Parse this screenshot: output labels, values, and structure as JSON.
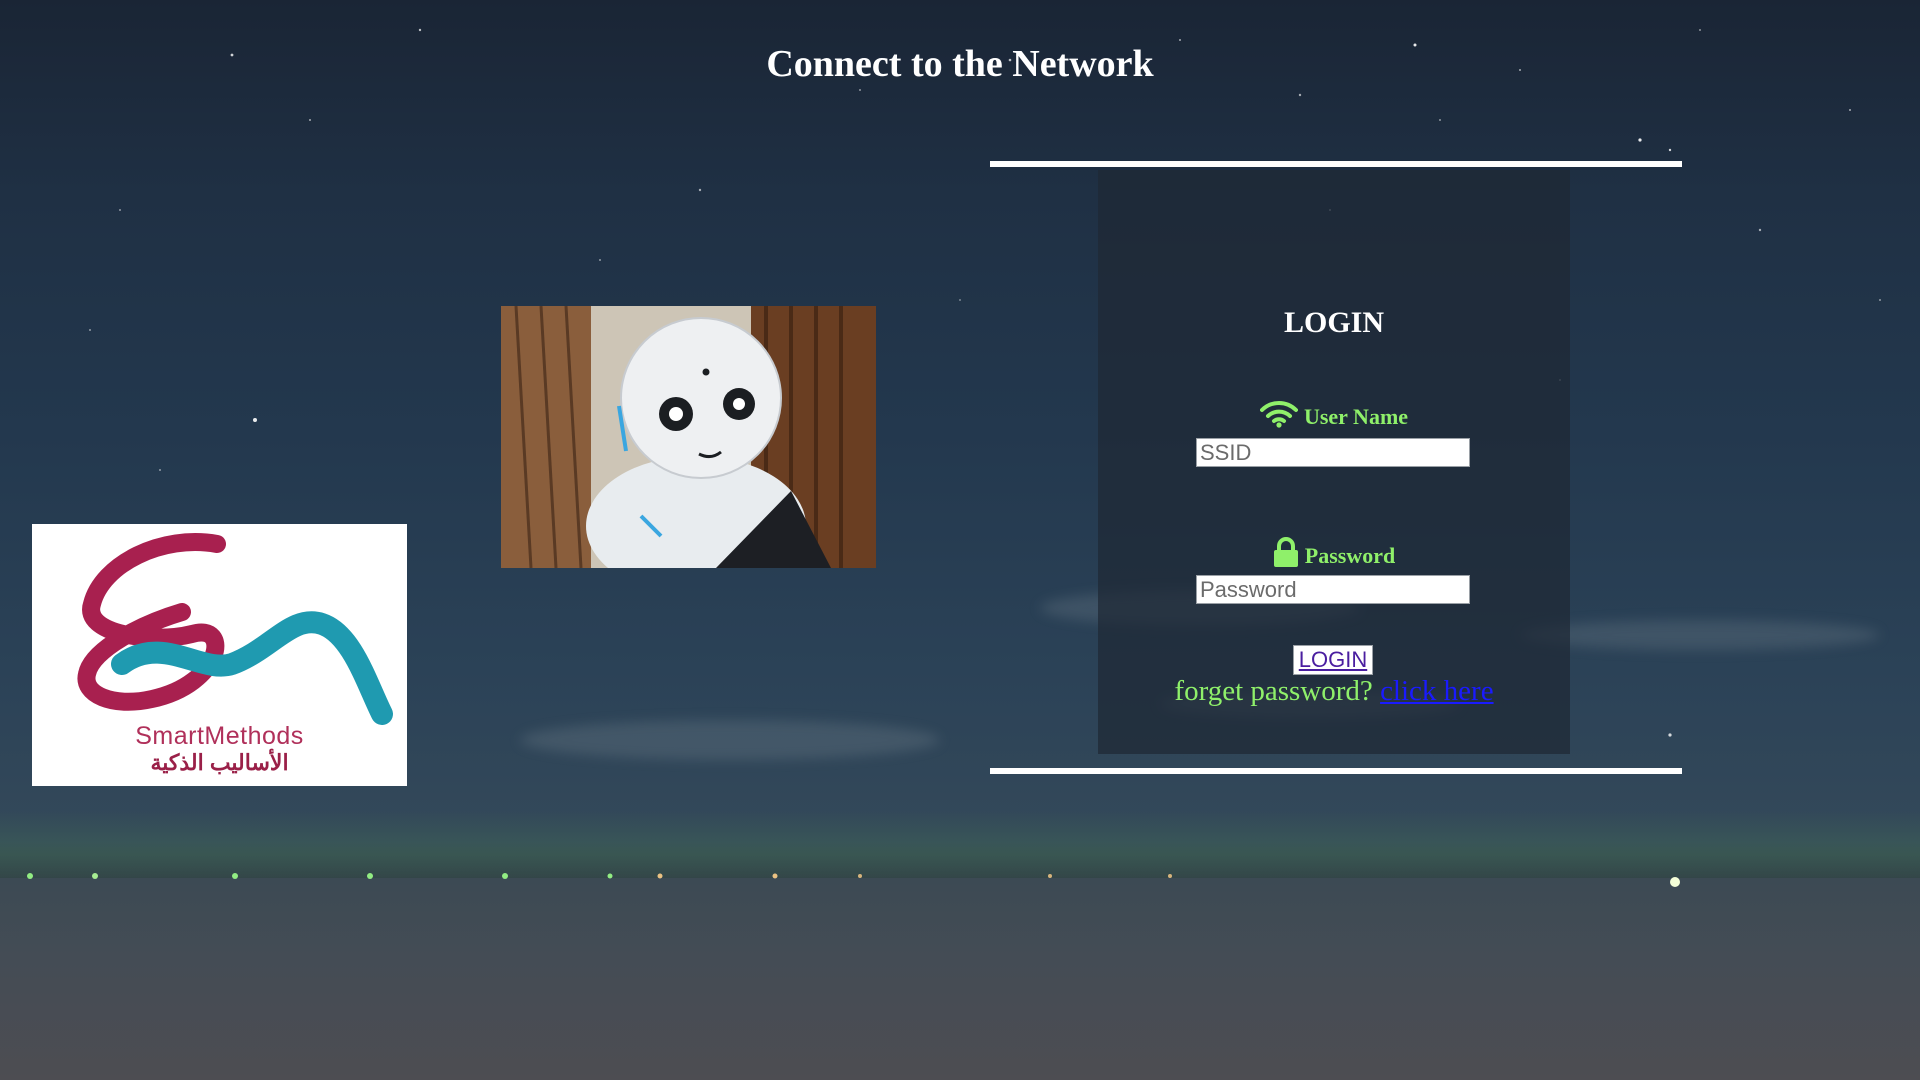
{
  "page": {
    "title": "Connect to the Network"
  },
  "logo": {
    "name_en": "SmartMethods",
    "name_ar": "الأساليب الذكية",
    "colors": {
      "magenta": "#b0305a",
      "teal": "#1f9ab0"
    }
  },
  "robot_image": {
    "icon": "robot-photo"
  },
  "login": {
    "heading": "LOGIN",
    "username": {
      "label": "User Name",
      "icon": "wifi-icon",
      "placeholder": "SSID",
      "value": ""
    },
    "password": {
      "label": "Password",
      "icon": "lock-icon",
      "placeholder": "Password",
      "value": ""
    },
    "submit_label": "LOGIN",
    "forgot_text": "forget password?",
    "forgot_link": "click here"
  },
  "colors": {
    "label_green": "#8ff06a",
    "link_blue": "#1a1aff",
    "button_text": "#4a1ea0",
    "panel_bg": "#1e2834"
  }
}
